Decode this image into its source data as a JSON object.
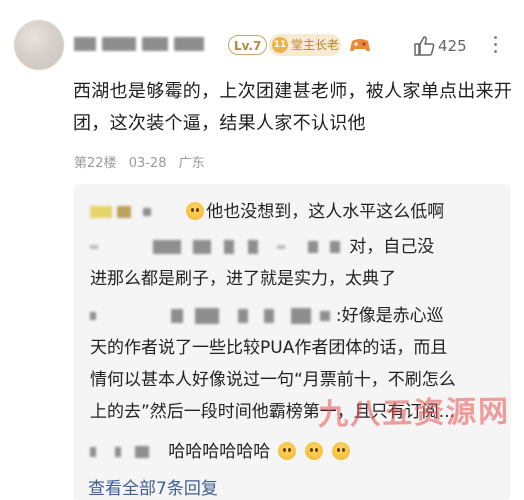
{
  "header": {
    "level_label": "Lv.7",
    "badge_label": "堂主长老",
    "badge_coin": "11",
    "like_count": "425"
  },
  "comment": {
    "text": "西湖也是够霉的，上次团建甚老师，被人家单点出来开团，这次装个逼，结果人家不认识他",
    "floor": "第22楼",
    "date": "03-28",
    "location": "广东"
  },
  "replies": {
    "r1": "他也没想到，这人水平这么低啊",
    "r2a": "对，自己没",
    "r2b": "进那么都是刷子，进了就是实力，太典了",
    "r3a": ":好像是赤心巡",
    "r3b": "天的作者说了一些比较PUA作者团体的话，而且",
    "r3c": "情何以甚本人好像说过一句“月票前十，不刷怎么",
    "r3d": "上的去”然后一段时间他霸榜第一，且只有订阅...",
    "r4": "哈哈哈哈哈哈"
  },
  "view_all": "查看全部7条回复",
  "watermark": "九八五资源网"
}
